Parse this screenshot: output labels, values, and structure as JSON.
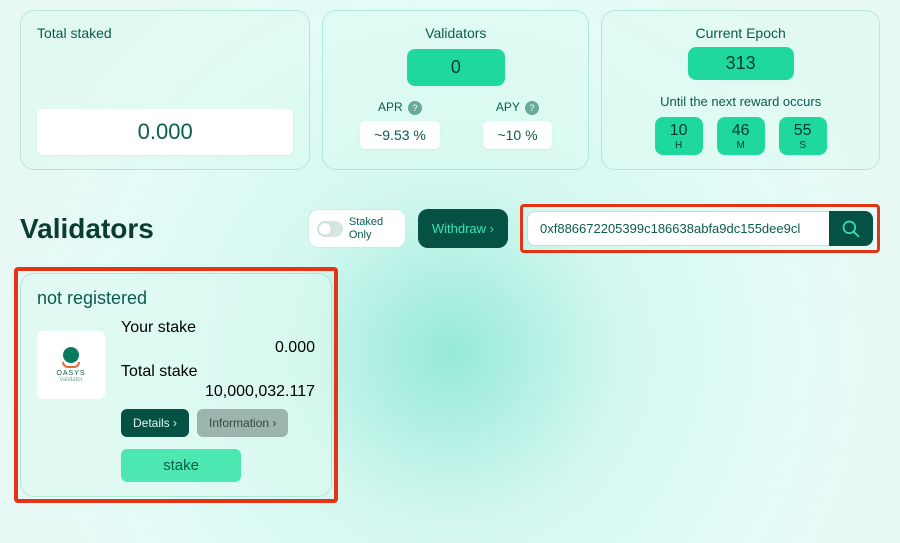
{
  "overview": {
    "total_staked_label": "Total staked",
    "total_staked_value": "0.000",
    "validators_label": "Validators",
    "validators_count": "0",
    "apr_label": "APR",
    "apr_value": "~9.53 %",
    "apy_label": "APY",
    "apy_value": "~10 %",
    "epoch_label": "Current Epoch",
    "epoch_value": "313",
    "next_reward_label": "Until the next reward occurs",
    "countdown": {
      "h": "10",
      "h_unit": "H",
      "m": "46",
      "m_unit": "M",
      "s": "55",
      "s_unit": "S"
    }
  },
  "section": {
    "title": "Validators",
    "staked_only_label": "Staked Only",
    "withdraw_label": "Withdraw ›",
    "search_value": "0xf886672205399c186638abfa9dc155dee9cl"
  },
  "validator_card": {
    "name": "not registered",
    "logo_main": "OASYS",
    "logo_sub": "Validator",
    "your_stake_label": "Your stake",
    "your_stake_value": "0.000",
    "total_stake_label": "Total stake",
    "total_stake_value": "10,000,032.117",
    "details_label": "Details ›",
    "information_label": "Information ›",
    "stake_label": "stake"
  }
}
